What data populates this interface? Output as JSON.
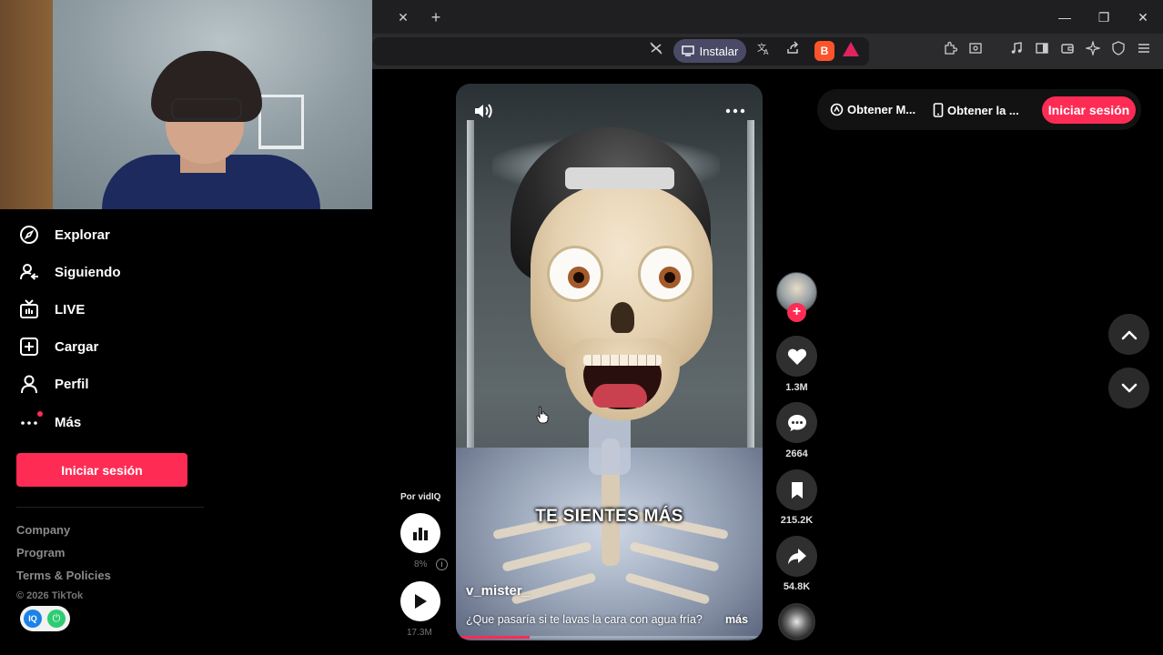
{
  "browser": {
    "tab_close": "✕",
    "new_tab": "+",
    "install_label": "Instalar",
    "window": {
      "minimize": "—",
      "restore": "❐",
      "close": "✕"
    }
  },
  "sidebar": {
    "items": [
      {
        "label": "Explorar",
        "icon": "compass-icon"
      },
      {
        "label": "Siguiendo",
        "icon": "following-icon"
      },
      {
        "label": "LIVE",
        "icon": "live-tv-icon"
      },
      {
        "label": "Cargar",
        "icon": "upload-plus-icon"
      },
      {
        "label": "Perfil",
        "icon": "person-icon"
      },
      {
        "label": "Más",
        "icon": "more-dots-icon"
      }
    ],
    "login_label": "Iniciar sesión",
    "footer": {
      "links": [
        "Company",
        "Program",
        "Terms & Policies"
      ],
      "copyright": "© 2026 TikTok"
    }
  },
  "vidiq": {
    "label": "Por vidIQ",
    "percent": "8%",
    "views": "17.3M"
  },
  "video": {
    "caption": "TE SIENTES MÁS",
    "author": "v_mister_",
    "description": "¿Que pasaría si te lavas la cara con agua fría?",
    "more_label": "más",
    "progress": 0.24
  },
  "actions": {
    "likes": "1.3M",
    "comments": "2664",
    "saves": "215.2K",
    "shares": "54.8K"
  },
  "topbar": {
    "link1": "Obtener M...",
    "link2": "Obtener la ...",
    "login_label": "Iniciar sesión"
  },
  "colors": {
    "brand": "#fe2c55",
    "background": "#000000"
  }
}
